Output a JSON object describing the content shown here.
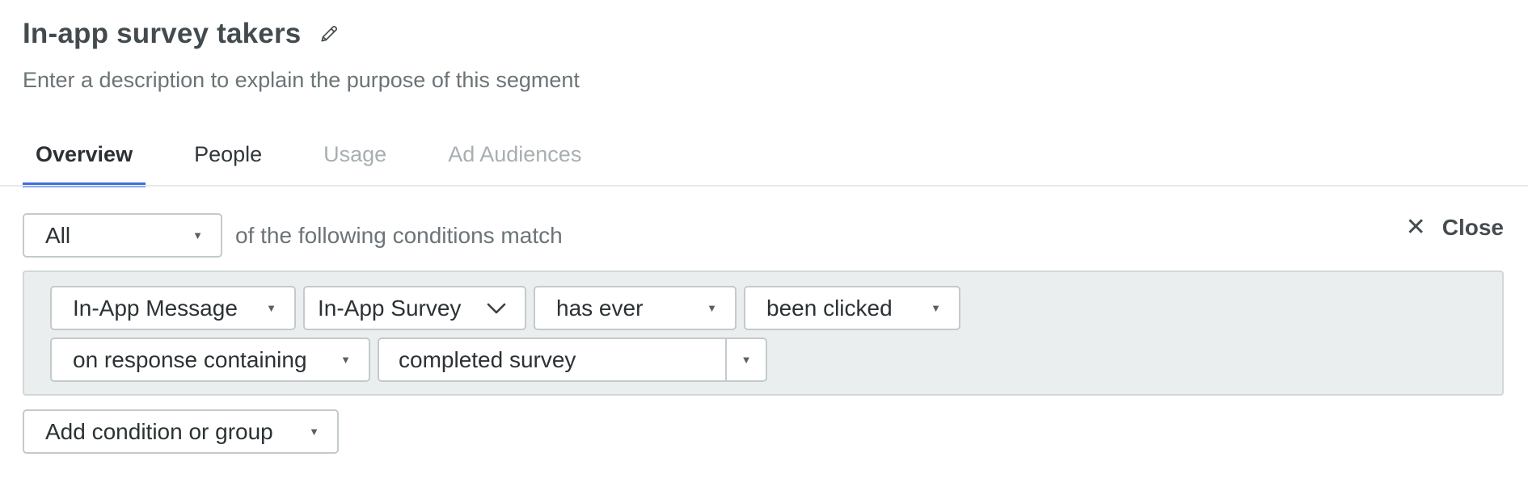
{
  "segment": {
    "title": "In-app survey takers",
    "description": "Enter a description to explain the purpose of this segment"
  },
  "tabs": [
    {
      "label": "Overview",
      "state": "active"
    },
    {
      "label": "People",
      "state": "normal"
    },
    {
      "label": "Usage",
      "state": "disabled"
    },
    {
      "label": "Ad Audiences",
      "state": "disabled"
    }
  ],
  "filter": {
    "match_value": "All",
    "match_suffix": "of the following conditions match",
    "close_label": "Close"
  },
  "conditions": {
    "row1": {
      "type": "In-App Message",
      "subtype": "In-App Survey",
      "frequency": "has ever",
      "action": "been clicked"
    },
    "row2": {
      "qualifier": "on response containing",
      "value": "completed survey"
    }
  },
  "add_condition_label": "Add condition or group",
  "icons": {
    "edit": "pencil-icon",
    "close": "close-icon",
    "caret": "caret-down-icon",
    "chevron": "chevron-down-icon"
  },
  "colors": {
    "accent": "#3c6fe0",
    "condition_bg": "#ebeeef"
  }
}
